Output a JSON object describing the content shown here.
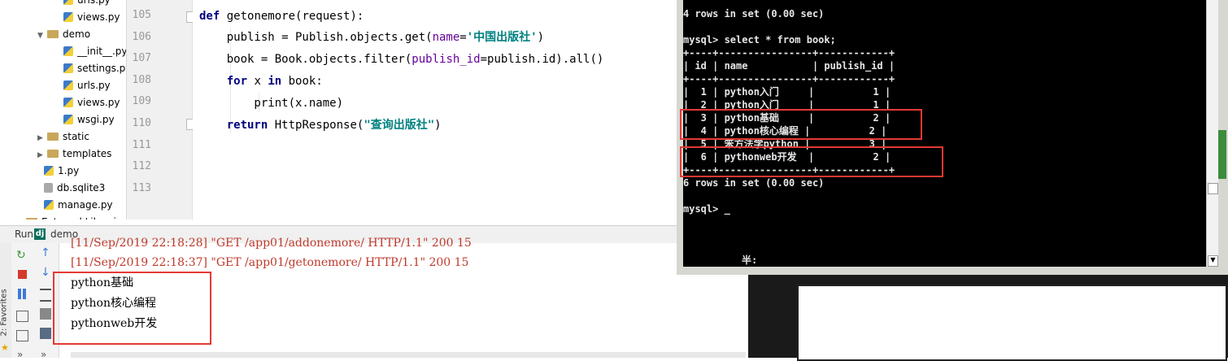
{
  "tree": {
    "items": [
      {
        "label": "urls.py",
        "kind": "py",
        "indent": 2
      },
      {
        "label": "views.py",
        "kind": "py",
        "indent": 2
      },
      {
        "label": "demo",
        "kind": "folder",
        "indent": 1,
        "expanded": true
      },
      {
        "label": "__init__.py",
        "kind": "py",
        "indent": 2
      },
      {
        "label": "settings.py",
        "kind": "py",
        "indent": 2
      },
      {
        "label": "urls.py",
        "kind": "py",
        "indent": 2
      },
      {
        "label": "views.py",
        "kind": "py",
        "indent": 2
      },
      {
        "label": "wsgi.py",
        "kind": "py",
        "indent": 2
      },
      {
        "label": "static",
        "kind": "folder",
        "indent": 1,
        "expanded": false
      },
      {
        "label": "templates",
        "kind": "folder",
        "indent": 1,
        "expanded": false
      },
      {
        "label": "1.py",
        "kind": "py",
        "indent": 1
      },
      {
        "label": "db.sqlite3",
        "kind": "db",
        "indent": 1
      },
      {
        "label": "manage.py",
        "kind": "py",
        "indent": 1
      },
      {
        "label": "External Libraries",
        "kind": "lib",
        "indent": 0,
        "expanded": false
      }
    ]
  },
  "editor": {
    "line_numbers": [
      "105",
      "106",
      "107",
      "108",
      "109",
      "110",
      "111",
      "112",
      "113"
    ],
    "code": {
      "l105_def": "def",
      "l105_rest": " getonemore(request):",
      "l106_a": "    publish = Publish.objects.get(",
      "l106_param": "name",
      "l106_eq": "=",
      "l106_str": "'中国出版社'",
      "l106_end": ")",
      "l107_a": "    book = Book.objects.filter(",
      "l107_param": "publish_id",
      "l107_end": "=publish.id).all()",
      "l108_for": "for",
      "l108_x": " x ",
      "l108_in": "in",
      "l108_end": " book:",
      "l109": "        print(x.name)",
      "l110_return": "return",
      "l110_mid": " HttpResponse(",
      "l110_str": "\"查询出版社\"",
      "l110_end": ")"
    }
  },
  "run": {
    "run_label": "Run",
    "config_name": "demo",
    "favorites_label": "2: Favorites",
    "log_lines": [
      "[11/Sep/2019 22:18:28] \"GET /app01/addonemore/ HTTP/1.1\" 200 15",
      "[11/Sep/2019 22:18:37] \"GET /app01/getonemore/ HTTP/1.1\" 200 15"
    ],
    "output_lines": [
      "python基础",
      "python核心编程",
      "pythonweb开发"
    ]
  },
  "terminal": {
    "lines": [
      "4 rows in set (0.00 sec)",
      "",
      "mysql> select * from book;",
      "+----+----------------+------------+",
      "| id | name           | publish_id |",
      "+----+----------------+------------+",
      "|  1 | python入门     |          1 |",
      "|  2 | python入门     |          1 |",
      "|  3 | python基础     |          2 |",
      "|  4 | python核心编程 |          2 |",
      "|  5 | 笨方法学python |          3 |",
      "|  6 | pythonweb开发  |          2 |",
      "+----+----------------+------------+",
      "6 rows in set (0.00 sec)",
      "",
      "mysql> _"
    ],
    "ime_status": "半:"
  },
  "colors": {
    "highlight": "#e53935",
    "keyword": "#000080",
    "string": "#008080",
    "param": "#660099",
    "log": "#c0392b"
  }
}
